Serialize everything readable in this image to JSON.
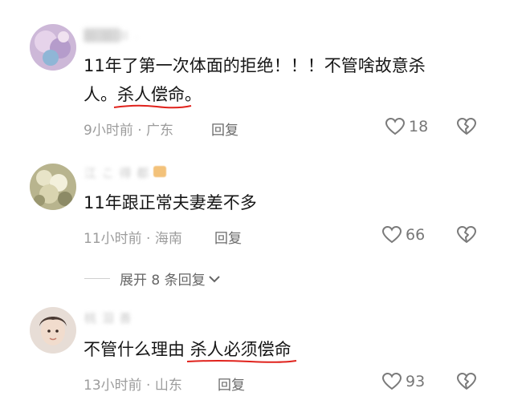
{
  "comments": [
    {
      "username": "■ ■ ■ .",
      "text_line1": "11年了第一次体面的拒绝！！！不管啥故意杀",
      "text_line2_pre": "人。",
      "text_line2_highlight": "杀人偿命",
      "text_line2_post": "。",
      "time": "9小时前",
      "location": "广东",
      "reply_label": "回复",
      "likes": "18"
    },
    {
      "username": "江 こ 得 都",
      "text": "11年跟正常夫妻差不多",
      "time": "11小时前",
      "location": "海南",
      "reply_label": "回复",
      "likes": "66"
    },
    {
      "username": "桃 泪 善 ",
      "text_pre": "不管什么理由 ",
      "text_highlight": "杀人必须偿命",
      "time": "13小时前",
      "location": "山东",
      "reply_label": "回复",
      "likes": "93"
    }
  ],
  "expand_replies": "展开 8 条回复",
  "colors": {
    "underline": "#e0221c",
    "icon": "#7a7a7a"
  },
  "icons": {
    "like": "heart-outline-icon",
    "dislike": "broken-heart-icon",
    "expand": "chevron-down-icon"
  }
}
